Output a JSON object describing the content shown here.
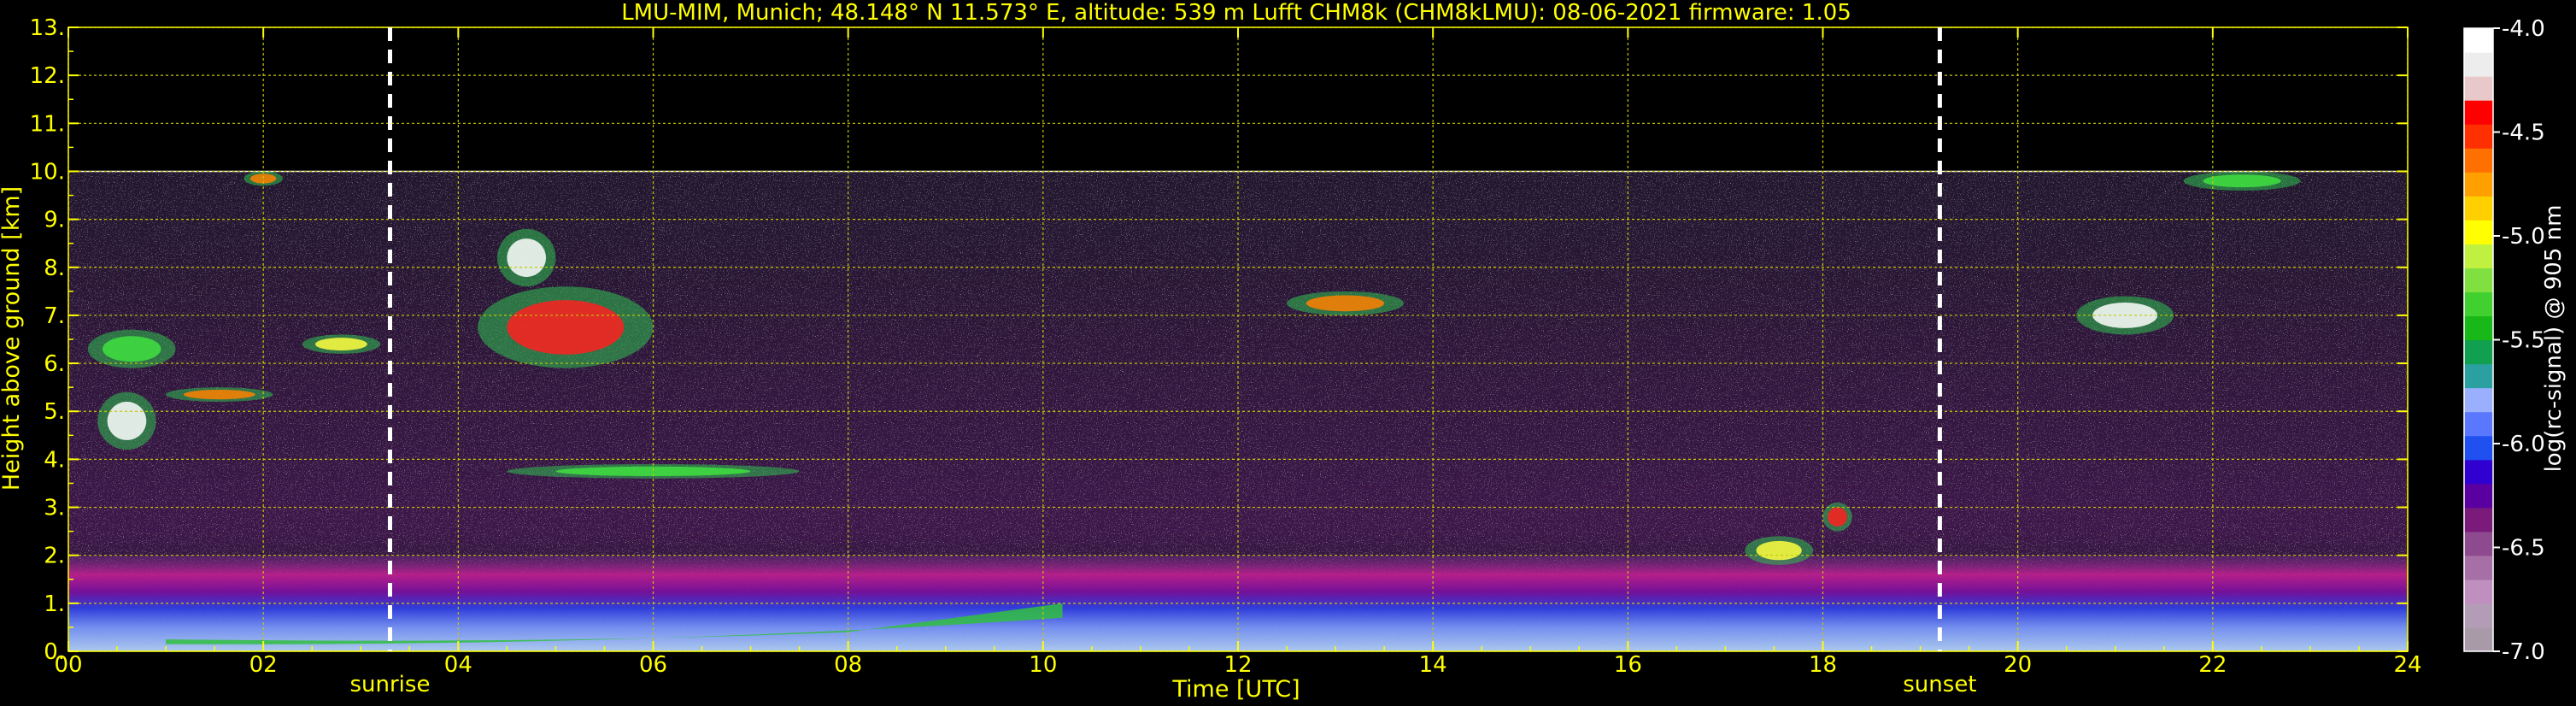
{
  "chart_data": {
    "type": "heatmap",
    "title": "LMU-MIM, Munich; 48.148° N 11.573° E, altitude: 539 m    Lufft CHM8k (CHM8kLMU): 08-06-2021    firmware: 1.05",
    "xlabel": "Time [UTC]",
    "ylabel": "Height above ground [km]",
    "xlim": [
      0,
      24
    ],
    "ylim": [
      0,
      13
    ],
    "x_ticks": [
      "00",
      "02",
      "04",
      "06",
      "08",
      "10",
      "12",
      "14",
      "16",
      "18",
      "20",
      "22",
      "24"
    ],
    "x_tick_values": [
      0,
      2,
      4,
      6,
      8,
      10,
      12,
      14,
      16,
      18,
      20,
      22,
      24
    ],
    "y_ticks": [
      "0.",
      "1.",
      "2.",
      "3.",
      "4.",
      "5.",
      "6.",
      "7.",
      "8.",
      "9.",
      "10.",
      "11.",
      "12.",
      "13."
    ],
    "y_tick_values": [
      0,
      1,
      2,
      3,
      4,
      5,
      6,
      7,
      8,
      9,
      10,
      11,
      12,
      13
    ],
    "x_minor_step": 0.5,
    "y_minor_step": 0.5,
    "grid": true,
    "data_ceiling_km": 10,
    "annotations": [
      {
        "label": "sunrise",
        "x": 3.3
      },
      {
        "label": "sunset",
        "x": 19.2
      }
    ],
    "colorbar": {
      "label": "log(rc-signal) @ 905 nm",
      "range": [
        -7.0,
        -4.0
      ],
      "ticks": [
        "-4.0",
        "-4.5",
        "-5.0",
        "-5.5",
        "-6.0",
        "-6.5",
        "-7.0"
      ],
      "tick_values": [
        -4.0,
        -4.5,
        -5.0,
        -5.5,
        -6.0,
        -6.5,
        -7.0
      ],
      "colors": [
        "#a89aa8",
        "#b39db6",
        "#bf8fbf",
        "#a670a6",
        "#8e4a8e",
        "#7a1a7a",
        "#5a00a0",
        "#3000d0",
        "#2050f0",
        "#5a78ff",
        "#9ab0ff",
        "#2aa0a0",
        "#10a050",
        "#18b818",
        "#40d030",
        "#80e040",
        "#c0f040",
        "#ffff00",
        "#ffd000",
        "#ffa000",
        "#ff7000",
        "#ff3000",
        "#ff0000",
        "#e8c8c8",
        "#ededed",
        "#ffffff"
      ]
    },
    "features": [
      {
        "kind": "boundary_layer",
        "x": [
          0,
          24
        ],
        "y": [
          0,
          2
        ]
      },
      {
        "kind": "cloud",
        "x": [
          0.3,
          0.9
        ],
        "y": [
          4.2,
          5.4
        ]
      },
      {
        "kind": "cloud",
        "x": [
          0.2,
          1.1
        ],
        "y": [
          5.9,
          6.7
        ]
      },
      {
        "kind": "cloud",
        "x": [
          1.0,
          2.1
        ],
        "y": [
          5.2,
          5.5
        ]
      },
      {
        "kind": "cloud",
        "x": [
          2.4,
          3.2
        ],
        "y": [
          6.2,
          6.6
        ]
      },
      {
        "kind": "cloud",
        "x": [
          4.2,
          6.0
        ],
        "y": [
          5.9,
          7.6
        ]
      },
      {
        "kind": "cloud",
        "x": [
          4.4,
          5.0
        ],
        "y": [
          7.6,
          8.8
        ]
      },
      {
        "kind": "cloud",
        "x": [
          4.5,
          7.5
        ],
        "y": [
          3.6,
          3.9
        ]
      },
      {
        "kind": "cloud",
        "x": [
          12.5,
          13.7
        ],
        "y": [
          7.0,
          7.5
        ]
      },
      {
        "kind": "cloud",
        "x": [
          17.2,
          17.9
        ],
        "y": [
          1.8,
          2.4
        ]
      },
      {
        "kind": "cloud",
        "x": [
          18.0,
          18.3
        ],
        "y": [
          2.5,
          3.1
        ]
      },
      {
        "kind": "cloud",
        "x": [
          20.6,
          21.6
        ],
        "y": [
          6.6,
          7.4
        ]
      },
      {
        "kind": "cloud",
        "x": [
          21.7,
          22.9
        ],
        "y": [
          9.6,
          10.0
        ]
      },
      {
        "kind": "cloud",
        "x": [
          1.8,
          2.2
        ],
        "y": [
          9.7,
          10.0
        ]
      }
    ]
  }
}
